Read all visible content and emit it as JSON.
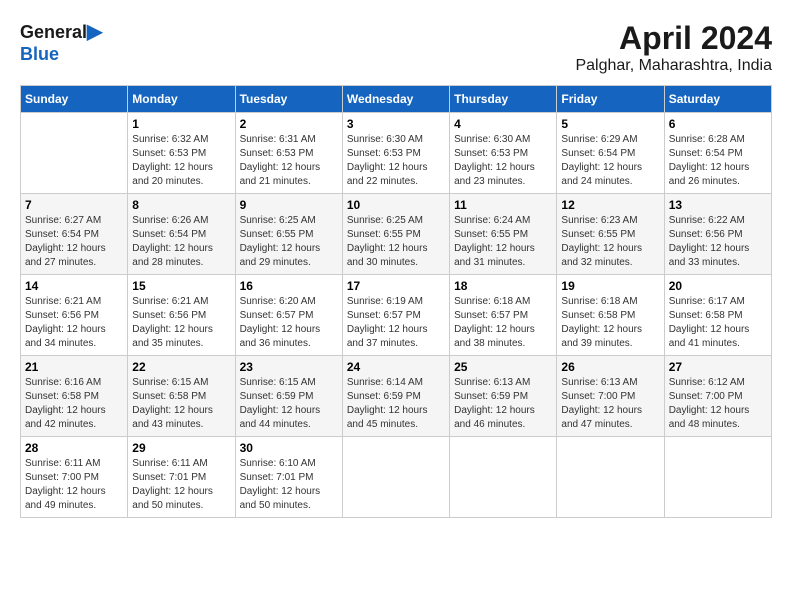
{
  "header": {
    "logo_line1": "General",
    "logo_line2": "Blue",
    "month": "April 2024",
    "location": "Palghar, Maharashtra, India"
  },
  "weekdays": [
    "Sunday",
    "Monday",
    "Tuesday",
    "Wednesday",
    "Thursday",
    "Friday",
    "Saturday"
  ],
  "weeks": [
    [
      {
        "day": null,
        "info": null
      },
      {
        "day": "1",
        "info": "Sunrise: 6:32 AM\nSunset: 6:53 PM\nDaylight: 12 hours\nand 20 minutes."
      },
      {
        "day": "2",
        "info": "Sunrise: 6:31 AM\nSunset: 6:53 PM\nDaylight: 12 hours\nand 21 minutes."
      },
      {
        "day": "3",
        "info": "Sunrise: 6:30 AM\nSunset: 6:53 PM\nDaylight: 12 hours\nand 22 minutes."
      },
      {
        "day": "4",
        "info": "Sunrise: 6:30 AM\nSunset: 6:53 PM\nDaylight: 12 hours\nand 23 minutes."
      },
      {
        "day": "5",
        "info": "Sunrise: 6:29 AM\nSunset: 6:54 PM\nDaylight: 12 hours\nand 24 minutes."
      },
      {
        "day": "6",
        "info": "Sunrise: 6:28 AM\nSunset: 6:54 PM\nDaylight: 12 hours\nand 26 minutes."
      }
    ],
    [
      {
        "day": "7",
        "info": "Sunrise: 6:27 AM\nSunset: 6:54 PM\nDaylight: 12 hours\nand 27 minutes."
      },
      {
        "day": "8",
        "info": "Sunrise: 6:26 AM\nSunset: 6:54 PM\nDaylight: 12 hours\nand 28 minutes."
      },
      {
        "day": "9",
        "info": "Sunrise: 6:25 AM\nSunset: 6:55 PM\nDaylight: 12 hours\nand 29 minutes."
      },
      {
        "day": "10",
        "info": "Sunrise: 6:25 AM\nSunset: 6:55 PM\nDaylight: 12 hours\nand 30 minutes."
      },
      {
        "day": "11",
        "info": "Sunrise: 6:24 AM\nSunset: 6:55 PM\nDaylight: 12 hours\nand 31 minutes."
      },
      {
        "day": "12",
        "info": "Sunrise: 6:23 AM\nSunset: 6:55 PM\nDaylight: 12 hours\nand 32 minutes."
      },
      {
        "day": "13",
        "info": "Sunrise: 6:22 AM\nSunset: 6:56 PM\nDaylight: 12 hours\nand 33 minutes."
      }
    ],
    [
      {
        "day": "14",
        "info": "Sunrise: 6:21 AM\nSunset: 6:56 PM\nDaylight: 12 hours\nand 34 minutes."
      },
      {
        "day": "15",
        "info": "Sunrise: 6:21 AM\nSunset: 6:56 PM\nDaylight: 12 hours\nand 35 minutes."
      },
      {
        "day": "16",
        "info": "Sunrise: 6:20 AM\nSunset: 6:57 PM\nDaylight: 12 hours\nand 36 minutes."
      },
      {
        "day": "17",
        "info": "Sunrise: 6:19 AM\nSunset: 6:57 PM\nDaylight: 12 hours\nand 37 minutes."
      },
      {
        "day": "18",
        "info": "Sunrise: 6:18 AM\nSunset: 6:57 PM\nDaylight: 12 hours\nand 38 minutes."
      },
      {
        "day": "19",
        "info": "Sunrise: 6:18 AM\nSunset: 6:58 PM\nDaylight: 12 hours\nand 39 minutes."
      },
      {
        "day": "20",
        "info": "Sunrise: 6:17 AM\nSunset: 6:58 PM\nDaylight: 12 hours\nand 41 minutes."
      }
    ],
    [
      {
        "day": "21",
        "info": "Sunrise: 6:16 AM\nSunset: 6:58 PM\nDaylight: 12 hours\nand 42 minutes."
      },
      {
        "day": "22",
        "info": "Sunrise: 6:15 AM\nSunset: 6:58 PM\nDaylight: 12 hours\nand 43 minutes."
      },
      {
        "day": "23",
        "info": "Sunrise: 6:15 AM\nSunset: 6:59 PM\nDaylight: 12 hours\nand 44 minutes."
      },
      {
        "day": "24",
        "info": "Sunrise: 6:14 AM\nSunset: 6:59 PM\nDaylight: 12 hours\nand 45 minutes."
      },
      {
        "day": "25",
        "info": "Sunrise: 6:13 AM\nSunset: 6:59 PM\nDaylight: 12 hours\nand 46 minutes."
      },
      {
        "day": "26",
        "info": "Sunrise: 6:13 AM\nSunset: 7:00 PM\nDaylight: 12 hours\nand 47 minutes."
      },
      {
        "day": "27",
        "info": "Sunrise: 6:12 AM\nSunset: 7:00 PM\nDaylight: 12 hours\nand 48 minutes."
      }
    ],
    [
      {
        "day": "28",
        "info": "Sunrise: 6:11 AM\nSunset: 7:00 PM\nDaylight: 12 hours\nand 49 minutes."
      },
      {
        "day": "29",
        "info": "Sunrise: 6:11 AM\nSunset: 7:01 PM\nDaylight: 12 hours\nand 50 minutes."
      },
      {
        "day": "30",
        "info": "Sunrise: 6:10 AM\nSunset: 7:01 PM\nDaylight: 12 hours\nand 50 minutes."
      },
      {
        "day": null,
        "info": null
      },
      {
        "day": null,
        "info": null
      },
      {
        "day": null,
        "info": null
      },
      {
        "day": null,
        "info": null
      }
    ]
  ]
}
